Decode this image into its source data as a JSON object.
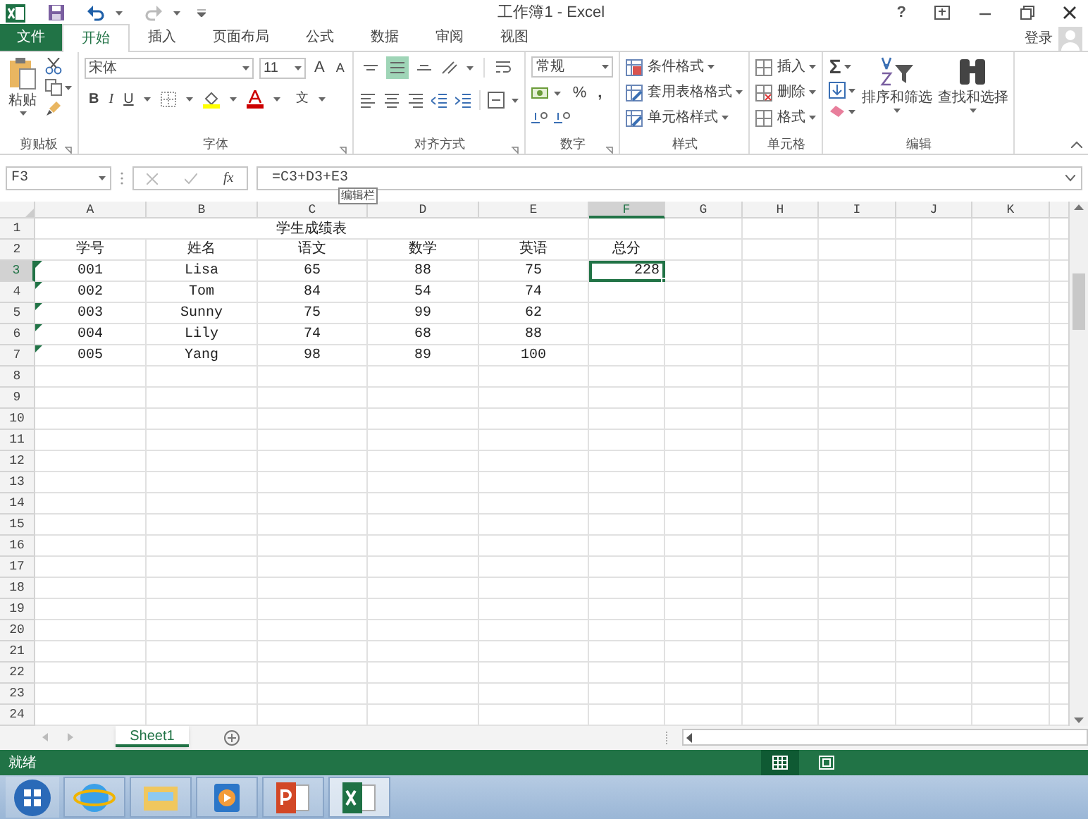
{
  "title_bar": {
    "title": "工作簿1 - Excel",
    "help": "?"
  },
  "tabs": [
    {
      "label": "文件",
      "kind": "file",
      "selected": false
    },
    {
      "label": "开始",
      "kind": "tab",
      "selected": true
    },
    {
      "label": "插入",
      "kind": "tab",
      "selected": false
    },
    {
      "label": "页面布局",
      "kind": "tab",
      "selected": false
    },
    {
      "label": "公式",
      "kind": "tab",
      "selected": false
    },
    {
      "label": "数据",
      "kind": "tab",
      "selected": false
    },
    {
      "label": "审阅",
      "kind": "tab",
      "selected": false
    },
    {
      "label": "视图",
      "kind": "tab",
      "selected": false
    }
  ],
  "account": {
    "label": "登录"
  },
  "ribbon": {
    "clipboard": {
      "label": "剪贴板",
      "paste": "粘贴"
    },
    "font": {
      "label": "字体",
      "font_name": "宋体",
      "font_size": "11",
      "grow": "A",
      "shrink": "A",
      "bold": "B",
      "italic": "I",
      "underline": "U",
      "phonetic": "文"
    },
    "alignment": {
      "label": "对齐方式",
      "vertical": [
        {
          "kind": "top",
          "selected": false
        },
        {
          "kind": "middle",
          "selected": true
        },
        {
          "kind": "bottom",
          "selected": false
        }
      ]
    },
    "number": {
      "label": "数字",
      "format": "常规",
      "percent": "%",
      "comma": ","
    },
    "styles": {
      "label": "样式",
      "items": [
        "条件格式",
        "套用表格格式",
        "单元格样式"
      ]
    },
    "cells": {
      "label": "单元格",
      "items": [
        "插入",
        "删除",
        "格式"
      ]
    },
    "editing": {
      "label": "编辑",
      "sum": "Σ",
      "sort": "排序和筛选",
      "find": "查找和选择"
    }
  },
  "formula_bar": {
    "name_box": "F3",
    "fx": "fx",
    "formula": "=C3+D3+E3",
    "tooltip": "编辑栏"
  },
  "sheet": {
    "columns": [
      {
        "label": "A",
        "selected": false
      },
      {
        "label": "B",
        "selected": false
      },
      {
        "label": "C",
        "selected": false
      },
      {
        "label": "D",
        "selected": false
      },
      {
        "label": "E",
        "selected": false
      },
      {
        "label": "F",
        "selected": true
      },
      {
        "label": "G",
        "selected": false
      },
      {
        "label": "H",
        "selected": false
      },
      {
        "label": "I",
        "selected": false
      },
      {
        "label": "J",
        "selected": false
      },
      {
        "label": "K",
        "selected": false
      }
    ],
    "rows": [
      {
        "number": "1",
        "title": "学生成绩表",
        "selected": false
      },
      {
        "number": "2",
        "cells": [
          "学号",
          "姓名",
          "语文",
          "数学",
          "英语",
          "总分"
        ],
        "selected": false
      },
      {
        "number": "3",
        "cells": [
          "001",
          "Lisa",
          "65",
          "88",
          "75",
          "228"
        ],
        "selected": true,
        "text_flag": true
      },
      {
        "number": "4",
        "cells": [
          "002",
          "Tom",
          "84",
          "54",
          "74"
        ],
        "selected": false,
        "text_flag": true
      },
      {
        "number": "5",
        "cells": [
          "003",
          "Sunny",
          "75",
          "99",
          "62"
        ],
        "selected": false,
        "text_flag": true
      },
      {
        "number": "6",
        "cells": [
          "004",
          "Lily",
          "74",
          "68",
          "88"
        ],
        "selected": false,
        "text_flag": true
      },
      {
        "number": "7",
        "cells": [
          "005",
          "Yang",
          "98",
          "89",
          "100"
        ],
        "selected": false,
        "text_flag": true
      },
      {
        "number": "8",
        "selected": false
      },
      {
        "number": "9",
        "selected": false
      },
      {
        "number": "10",
        "selected": false
      },
      {
        "number": "11",
        "selected": false
      },
      {
        "number": "12",
        "selected": false
      },
      {
        "number": "13",
        "selected": false
      },
      {
        "number": "14",
        "selected": false
      },
      {
        "number": "15",
        "selected": false
      },
      {
        "number": "16",
        "selected": false
      },
      {
        "number": "17",
        "selected": false
      },
      {
        "number": "18",
        "selected": false
      },
      {
        "number": "19",
        "selected": false
      },
      {
        "number": "20",
        "selected": false
      },
      {
        "number": "21",
        "selected": false
      },
      {
        "number": "22",
        "selected": false
      },
      {
        "number": "23",
        "selected": false
      },
      {
        "number": "24",
        "selected": false
      }
    ]
  },
  "sheet_tabs": [
    {
      "label": "Sheet1",
      "selected": true
    }
  ],
  "status_bar": {
    "text": "就绪"
  },
  "taskbar": [
    {
      "kind": "start",
      "selected": false
    },
    {
      "kind": "browser",
      "selected": false
    },
    {
      "kind": "folder",
      "selected": false
    },
    {
      "kind": "player",
      "selected": false
    },
    {
      "kind": "powerpoint",
      "selected": false
    },
    {
      "kind": "excel",
      "selected": true
    }
  ]
}
